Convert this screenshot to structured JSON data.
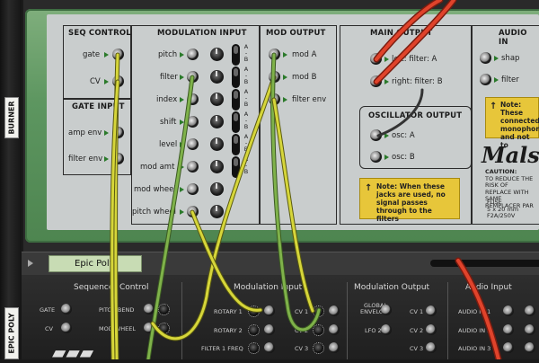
{
  "rack": {
    "device1_label": "BURNER",
    "device2_label": "EPIC POLY",
    "device_name_tag": "Epic Poly"
  },
  "seq_control": {
    "title": "SEQ CONTROL",
    "gate": "gate",
    "cv": "CV"
  },
  "gate_input": {
    "title": "GATE INPUT",
    "amp_env": "amp env",
    "filter_env": "filter env"
  },
  "modulation_input": {
    "title": "MODULATION INPUT",
    "items": [
      "pitch",
      "filter",
      "index",
      "shift",
      "level",
      "mod amt",
      "mod wheel",
      "pitch wheel"
    ],
    "switch_a": "A",
    "switch_b": "B"
  },
  "mod_output": {
    "title": "MOD OUTPUT",
    "mod_a": "mod A",
    "mod_b": "mod B",
    "filter_env": "filter env"
  },
  "main_output": {
    "title": "MAIN OUTPUT",
    "left": "left: filter: A",
    "right": "right: filter: B"
  },
  "oscillator_output": {
    "title": "OSCILLATOR OUTPUT",
    "osc_a": "osc: A",
    "osc_b": "osc: B",
    "note": "Note: When these jacks are used, no signal passes through to the filters"
  },
  "audio_input": {
    "title": "AUDIO IN",
    "shape": "shap",
    "filter": "filter",
    "note_lines": [
      "Note: These",
      "connected",
      "monophon",
      "and not to"
    ]
  },
  "brand": {
    "logo": "Mals",
    "caution_lines": [
      "CAUTION:",
      "TO REDUCE THE RISK OF",
      "REPLACE WITH SAME",
      "REMPLACER PAR"
    ],
    "fuse_lines": [
      "FUSE",
      "5 x 20 mm",
      "F2A/250V"
    ]
  },
  "epic_poly": {
    "sequencer_control": {
      "title": "Sequencer Control",
      "gate": "GATE",
      "cv": "CV",
      "pitch_bend": "PITCH BEND",
      "mod_wheel": "MOD WHEEL"
    },
    "modulation_input": {
      "title": "Modulation Input",
      "rotary1": "ROTARY 1",
      "rotary2": "ROTARY 2",
      "filter_freq": "FILTER 1 FREQ",
      "cv1": "CV 1",
      "cv2": "CV 2",
      "cv3": "CV 3"
    },
    "modulation_output": {
      "title": "Modulation Output",
      "global_envelope": "GLOBAL ENVELOPE",
      "lfo2": "LFO 2",
      "cv1": "CV 1",
      "cv2": "CV 2",
      "cv3": "CV 3"
    },
    "audio_input": {
      "title": "Audio Input",
      "audio1": "AUDIO IN 1",
      "audio2": "AUDIO IN 2",
      "audio3": "AUDIO IN 3"
    }
  },
  "colors": {
    "cable_yellow": "#d6d63a",
    "cable_green": "#7fb24a",
    "cable_red": "#e0432b",
    "frame_green": "#5d9660"
  }
}
